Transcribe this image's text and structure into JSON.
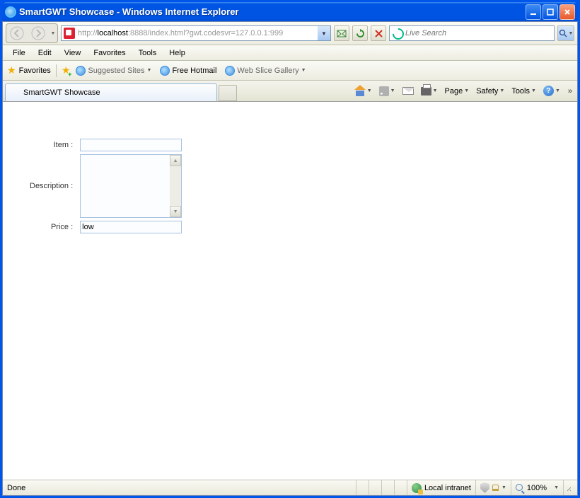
{
  "window": {
    "title": "SmartGWT Showcase - Windows Internet Explorer"
  },
  "address": {
    "prefix": "http://",
    "host": "localhost",
    "rest": ":8888/index.html?gwt.codesvr=127.0.0.1:999"
  },
  "search": {
    "placeholder": "Live Search"
  },
  "menu": {
    "file": "File",
    "edit": "Edit",
    "view": "View",
    "favorites": "Favorites",
    "tools": "Tools",
    "help": "Help"
  },
  "favbar": {
    "favorites": "Favorites",
    "suggested": "Suggested Sites",
    "hotmail": "Free Hotmail",
    "webslice": "Web Slice Gallery"
  },
  "tab": {
    "label": "SmartGWT Showcase"
  },
  "cmdbar": {
    "page": "Page",
    "safety": "Safety",
    "tools": "Tools"
  },
  "form": {
    "item_label": "Item :",
    "item_value": "",
    "desc_label": "Description :",
    "desc_value": "",
    "price_label": "Price :",
    "price_value": "low"
  },
  "status": {
    "done": "Done",
    "zone": "Local intranet",
    "zoom": "100%"
  }
}
